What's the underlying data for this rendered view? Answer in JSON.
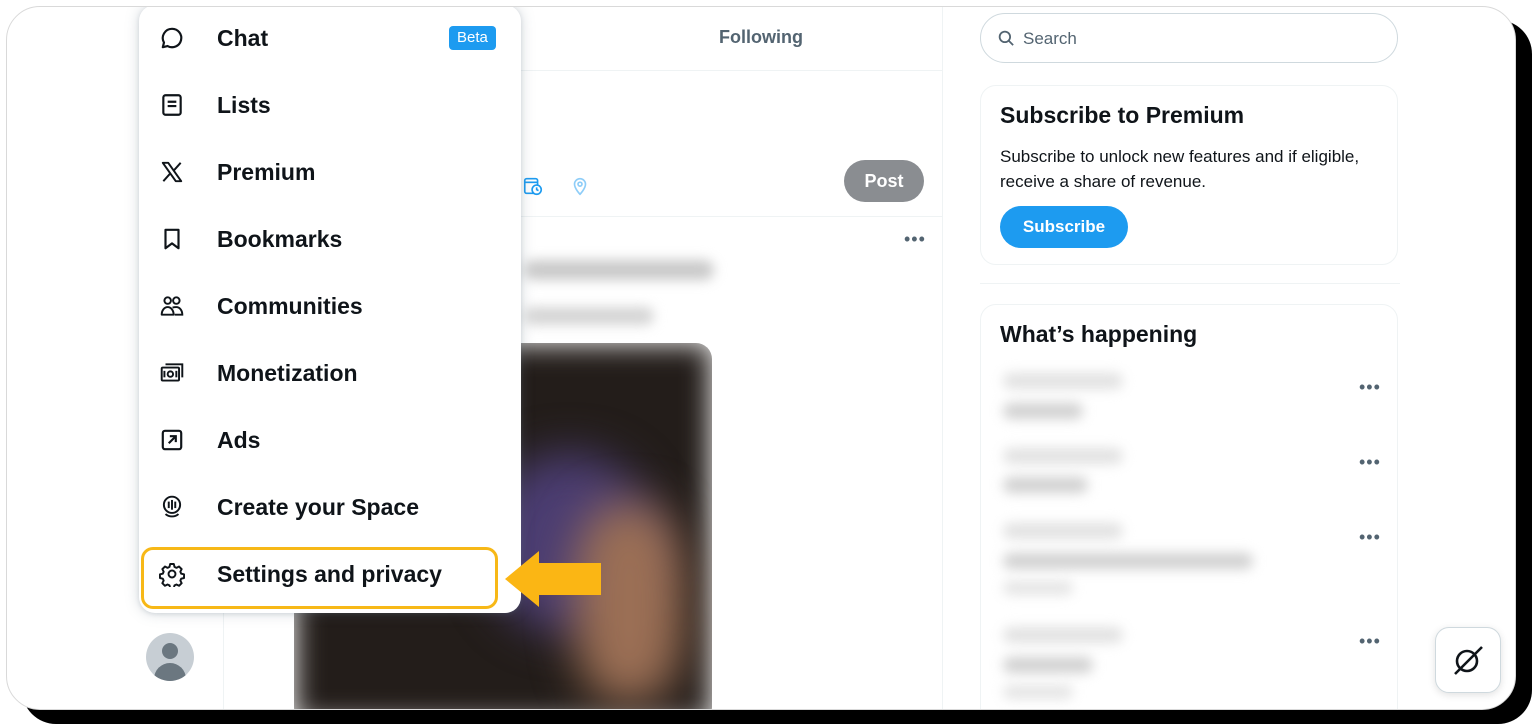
{
  "timeline": {
    "tab_following": "Following",
    "post_label": "Post"
  },
  "menu": {
    "items": [
      {
        "label": "Chat",
        "icon": "chat-bubble-icon",
        "badge": "Beta"
      },
      {
        "label": "Lists",
        "icon": "lists-icon"
      },
      {
        "label": "Premium",
        "icon": "x-logo-icon"
      },
      {
        "label": "Bookmarks",
        "icon": "bookmark-icon"
      },
      {
        "label": "Communities",
        "icon": "communities-icon"
      },
      {
        "label": "Monetization",
        "icon": "monetization-icon"
      },
      {
        "label": "Ads",
        "icon": "ads-icon"
      },
      {
        "label": "Create your Space",
        "icon": "spaces-icon"
      },
      {
        "label": "Settings and privacy",
        "icon": "gear-icon",
        "highlighted": true
      }
    ]
  },
  "sidebar_right": {
    "search": {
      "placeholder": "Search"
    },
    "premium": {
      "title": "Subscribe to Premium",
      "description": "Subscribe to unlock new features and if eligible, receive a share of revenue.",
      "button": "Subscribe"
    },
    "happening": {
      "title": "What’s happening"
    }
  },
  "colors": {
    "accent": "#1d9bf0",
    "highlight": "#f7b817",
    "text": "#0f1419",
    "muted": "#536471",
    "post_button_disabled": "#8a8d91"
  }
}
